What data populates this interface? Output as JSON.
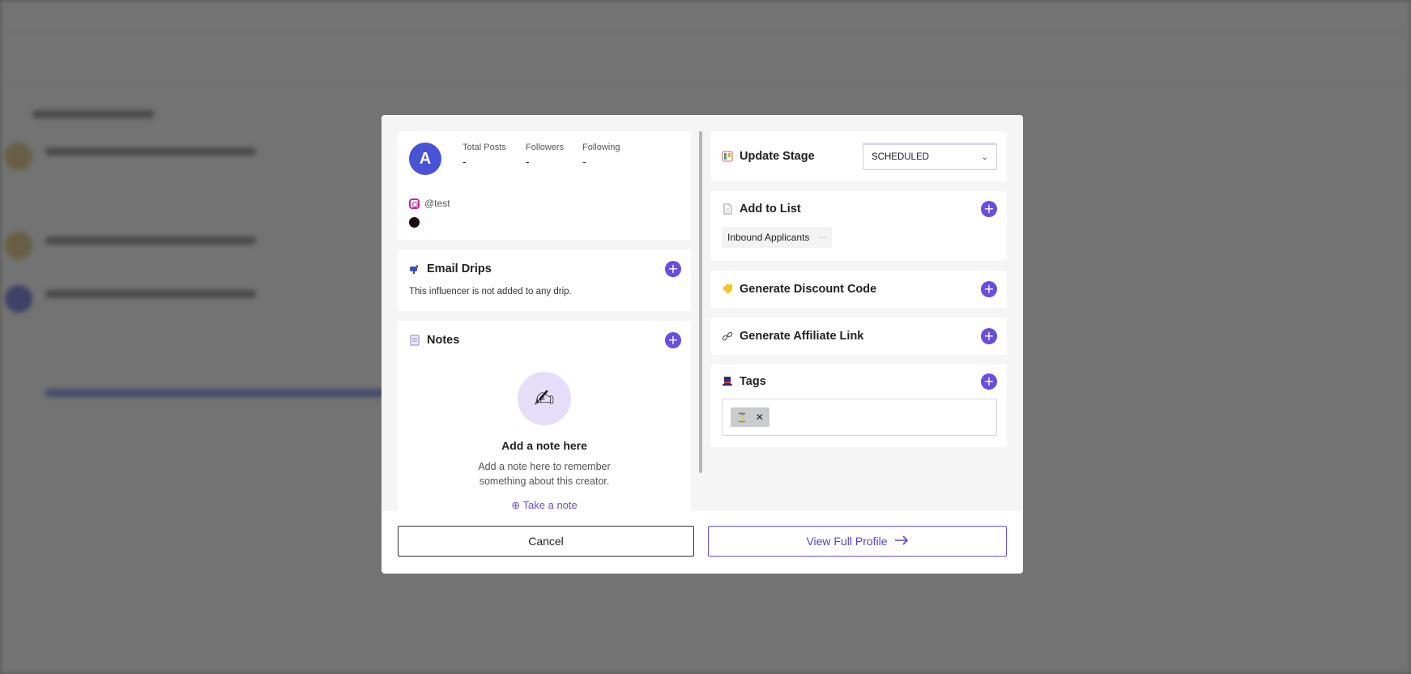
{
  "profile": {
    "avatar_letter": "A",
    "stats": [
      {
        "label": "Total Posts",
        "value": "-"
      },
      {
        "label": "Followers",
        "value": "-"
      },
      {
        "label": "Following",
        "value": "-"
      }
    ],
    "handle": "@test",
    "color_swatch": "#1a0a0a"
  },
  "email_drips": {
    "title": "Email Drips",
    "empty_text": "This influencer is not added to any drip.",
    "icon": "mailbox-icon"
  },
  "notes": {
    "title": "Notes",
    "empty_title": "Add a note here",
    "empty_desc": "Add a note here to remember something about this creator.",
    "take_note_label": "Take a note",
    "icon": "notepad-icon"
  },
  "update_stage": {
    "title": "Update Stage",
    "selected": "SCHEDULED"
  },
  "add_to_list": {
    "title": "Add to List",
    "items": [
      "Inbound Applicants"
    ],
    "more": "···"
  },
  "discount": {
    "title": "Generate Discount Code"
  },
  "affiliate": {
    "title": "Generate Affiliate Link"
  },
  "tags": {
    "title": "Tags",
    "items": [
      {
        "label": "⏳"
      }
    ]
  },
  "footer": {
    "cancel_label": "Cancel",
    "view_label": "View Full Profile"
  },
  "colors": {
    "accent": "#6a4ce0",
    "avatar_bg": "#4a52d6"
  }
}
